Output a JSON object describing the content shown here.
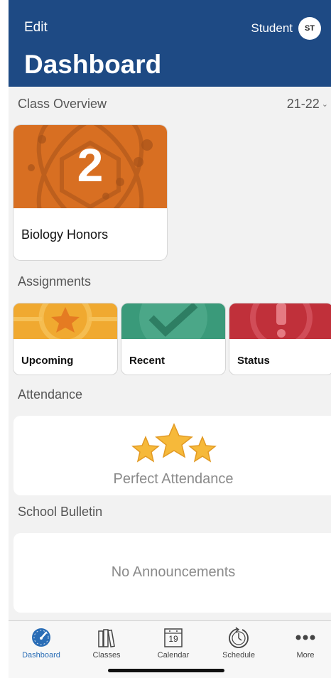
{
  "header": {
    "edit_label": "Edit",
    "user_name": "Student",
    "avatar_initials": "ST",
    "title": "Dashboard",
    "bg_color": "#1e4a84"
  },
  "class_overview": {
    "title": "Class Overview",
    "year": "21-22",
    "classes": [
      {
        "name": "Biology Honors",
        "count": "2",
        "color": "#d86f22"
      }
    ]
  },
  "assignments": {
    "title": "Assignments",
    "cards": [
      {
        "label": "Upcoming",
        "icon": "star-icon",
        "color": "#e99a2a"
      },
      {
        "label": "Recent",
        "icon": "check-icon",
        "color": "#3a9a7a"
      },
      {
        "label": "Status",
        "icon": "exclamation-icon",
        "color": "#c0303a"
      }
    ]
  },
  "attendance": {
    "title": "Attendance",
    "text": "Perfect Attendance",
    "icon": "stars-icon"
  },
  "bulletin": {
    "title": "School Bulletin",
    "empty_text": "No Announcements"
  },
  "tabbar": {
    "active": "Dashboard",
    "items": [
      {
        "label": "Dashboard",
        "icon": "gauge-icon"
      },
      {
        "label": "Classes",
        "icon": "books-icon"
      },
      {
        "label": "Calendar",
        "icon": "calendar-icon",
        "badge": "19"
      },
      {
        "label": "Schedule",
        "icon": "clock-icon"
      },
      {
        "label": "More",
        "icon": "more-dots-icon"
      }
    ]
  }
}
